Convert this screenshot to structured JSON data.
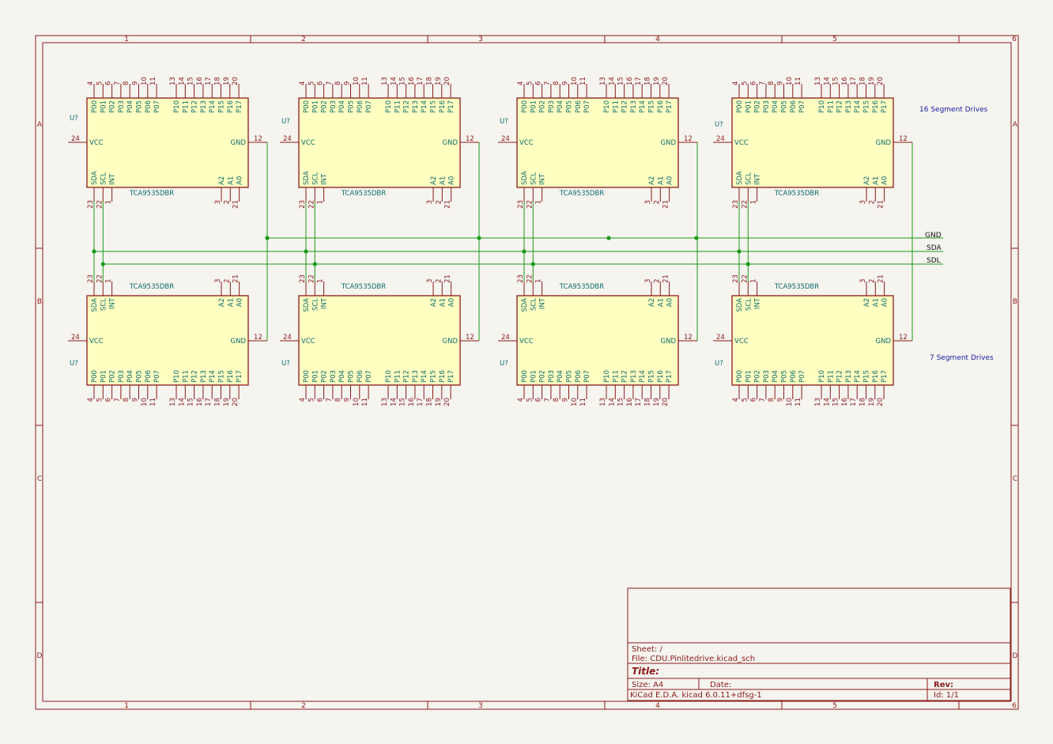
{
  "sheet": {
    "columns": [
      "1",
      "2",
      "3",
      "4",
      "5",
      "6"
    ],
    "rows": [
      "A",
      "B",
      "C",
      "D"
    ]
  },
  "components": {
    "value": "TCA9535DBR",
    "ref": "U?",
    "pins": {
      "top_left": [
        [
          "4",
          "P00"
        ],
        [
          "5",
          "P01"
        ],
        [
          "6",
          "P02"
        ],
        [
          "7",
          "P03"
        ],
        [
          "8",
          "P04"
        ],
        [
          "9",
          "P05"
        ],
        [
          "10",
          "P06"
        ],
        [
          "11",
          "P07"
        ]
      ],
      "top_right": [
        [
          "13",
          "P10"
        ],
        [
          "14",
          "P11"
        ],
        [
          "15",
          "P12"
        ],
        [
          "16",
          "P13"
        ],
        [
          "17",
          "P14"
        ],
        [
          "18",
          "P15"
        ],
        [
          "19",
          "P16"
        ],
        [
          "20",
          "P17"
        ]
      ],
      "bus": [
        [
          "23",
          "SDA"
        ],
        [
          "22",
          "SCL"
        ],
        [
          "1",
          "INT"
        ]
      ],
      "addr": [
        [
          "3",
          "A2"
        ],
        [
          "2",
          "A1"
        ],
        [
          "21",
          "A0"
        ]
      ],
      "vcc": [
        "24",
        "VCC"
      ],
      "gnd": [
        "12",
        "GND"
      ]
    }
  },
  "nets": {
    "gnd": "GND",
    "sda": "SDA",
    "sdl": "SDL"
  },
  "notes": {
    "top": "16 Segment Drives",
    "bottom": "7 Segment Drives"
  },
  "title_block": {
    "sheet": "Sheet: /",
    "file": "File: CDU.Pinlitedrive.kicad_sch",
    "title": "Title:",
    "size": "Size: A4",
    "date": "Date:",
    "rev": "Rev:",
    "generator": "KiCad E.D.A.  kicad 6.0.11+dfsg-1",
    "id": "Id: 1/1"
  }
}
